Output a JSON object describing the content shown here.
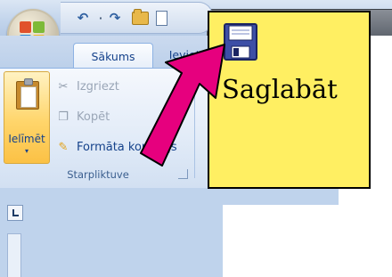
{
  "window": {
    "title": ""
  },
  "quick_access": {
    "icons": [
      "undo-icon",
      "redo-icon",
      "open-folder-icon",
      "new-document-icon"
    ],
    "separator": "·"
  },
  "tabs": [
    {
      "label": "Sākums",
      "active": true
    },
    {
      "label": "Ievieto",
      "active": false
    }
  ],
  "clipboard_group": {
    "paste_label": "Ielīmēt",
    "paste_dropdown": "▾",
    "commands": [
      {
        "label": "Izgriezt",
        "icon": "scissors-icon",
        "glyph": "✂",
        "enabled": false
      },
      {
        "label": "Kopēt",
        "icon": "copy-icon",
        "glyph": "❐",
        "enabled": false
      },
      {
        "label": "Formāta kopētājs",
        "icon": "format-painter-icon",
        "glyph": "✎",
        "enabled": true
      }
    ],
    "group_label": "Starpliktuve"
  },
  "callout": {
    "text": "Saglabāt",
    "icon": "save-floppy-icon",
    "background": "#ffef62"
  },
  "arrow": {
    "color": "#e6007e",
    "icon": "pointer-arrow"
  }
}
